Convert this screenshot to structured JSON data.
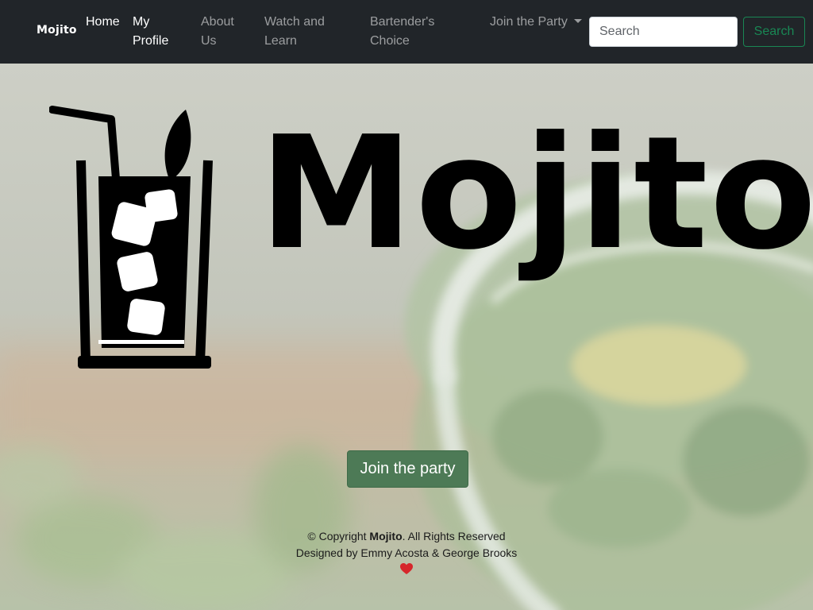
{
  "navbar": {
    "brand": "Mojito",
    "links": [
      {
        "label": "Home",
        "active": true
      },
      {
        "label": "My Profile",
        "active": true
      },
      {
        "label": "About Us",
        "active": false
      },
      {
        "label": "Watch and Learn",
        "active": false
      },
      {
        "label": "Bartender's Choice",
        "active": false
      }
    ],
    "dropdown_label": "Join the Party",
    "search": {
      "placeholder": "Search",
      "button_label": "Search"
    }
  },
  "hero": {
    "logo_text": "Mojito",
    "cta_label": "Join the party"
  },
  "footer": {
    "copyright_prefix": "© Copyright",
    "brand": "Mojito",
    "copyright_suffix": ". All Rights Reserved",
    "designed_by": "Designed by Emmy Acosta & George Brooks"
  },
  "icons": {
    "logo": "cocktail-glass-icon",
    "dropdown": "caret-down-icon",
    "footer": "heart-icon"
  },
  "colors": {
    "navbar_bg": "#212529",
    "accent_green": "#198754",
    "cta_bg": "#4d7a56",
    "heart": "#d6262b"
  }
}
